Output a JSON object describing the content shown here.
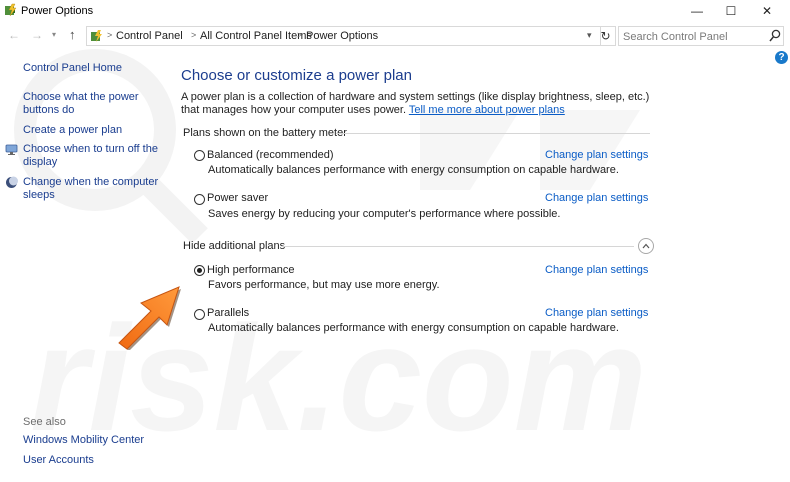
{
  "window": {
    "title": "Power Options",
    "minimize_glyph": "—",
    "maximize_glyph": "☐",
    "close_glyph": "✕"
  },
  "address_bar": {
    "breadcrumbs": [
      "Control Panel",
      "All Control Panel Items",
      "Power Options"
    ],
    "search_placeholder": "Search Control Panel"
  },
  "help": {
    "glyph": "?"
  },
  "sidebar": {
    "home": "Control Panel Home",
    "links": [
      {
        "label_line1": "Choose what the power",
        "label_line2": "buttons do"
      },
      {
        "label_line1": "Create a power plan"
      },
      {
        "label_line1": "Choose when to turn off the",
        "label_line2": "display",
        "icon": "monitor-icon"
      },
      {
        "label_line1": "Change when the computer",
        "label_line2": "sleeps",
        "icon": "moon-icon"
      }
    ],
    "see_also": {
      "label": "See also",
      "links": [
        "Windows Mobility Center",
        "User Accounts"
      ]
    }
  },
  "main": {
    "title": "Choose or customize a power plan",
    "intro_text": "A power plan is a collection of hardware and system settings (like display brightness, sleep, etc.) that manages how your computer uses power. ",
    "intro_link": "Tell me more about power plans",
    "battery_group": {
      "label": "Plans shown on the battery meter",
      "plans": [
        {
          "name": "Balanced (recommended)",
          "description": "Automatically balances performance with energy consumption on capable hardware.",
          "selected": false,
          "link": "Change plan settings"
        },
        {
          "name": "Power saver",
          "description": "Saves energy by reducing your computer's performance where possible.",
          "selected": false,
          "link": "Change plan settings"
        }
      ]
    },
    "additional_group": {
      "label": "Hide additional plans",
      "plans": [
        {
          "name": "High performance",
          "description": "Favors performance, but may use more energy.",
          "selected": true,
          "link": "Change plan settings"
        },
        {
          "name": "Parallels",
          "description": "Automatically balances performance with energy consumption on capable hardware.",
          "selected": false,
          "link": "Change plan settings"
        }
      ]
    }
  },
  "watermark_text": "risk.com",
  "colors": {
    "link_blue": "#1a3d8f",
    "title_blue": "#1c3d8e",
    "hyperlink": "#0a5cc6",
    "arrow_orange": "#f47a20",
    "watermark": "#f0f0f0"
  }
}
